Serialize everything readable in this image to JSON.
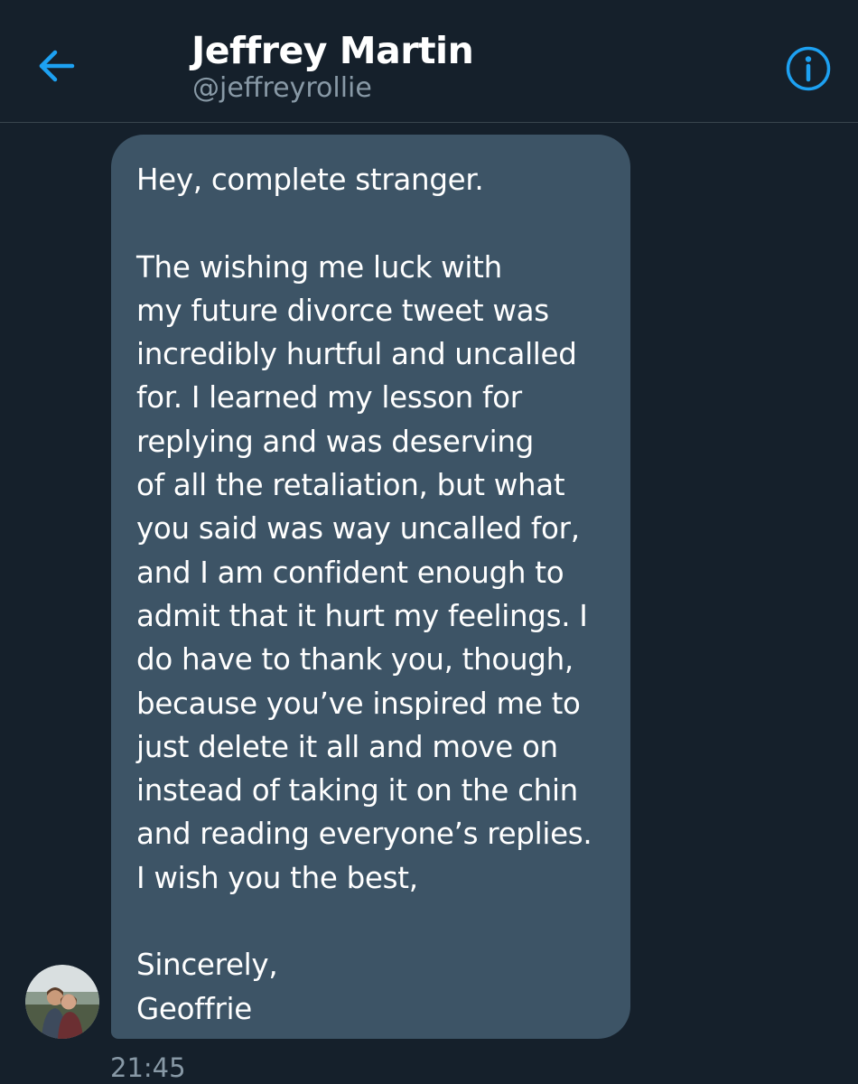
{
  "header": {
    "back_icon": "arrow-left-icon",
    "title": "Jeffrey Martin",
    "handle": "@jeffreyrollie",
    "info_icon": "info-icon"
  },
  "conversation": {
    "message": {
      "text": "Hey, complete stranger.\n\nThe wishing me luck with\nmy future divorce tweet was\nincredibly hurtful and uncalled\nfor. I learned my lesson for\nreplying and was deserving\nof all the retaliation, but what\nyou said was way uncalled for,\nand I am confident enough to\nadmit that it hurt my feelings. I\ndo have to thank you, though,\nbecause you’ve inspired me to\njust delete it all and move on\ninstead of taking it on the chin\nand reading everyone’s replies.\nI wish you the best,\n\nSincerely,\nGeoffrie",
      "time": "21:45",
      "avatar": "user-avatar"
    }
  },
  "colors": {
    "background": "#15202b",
    "bubble": "#3d5466",
    "accent": "#1da1f2",
    "secondary_text": "#8899a6",
    "divider": "#38444d"
  }
}
